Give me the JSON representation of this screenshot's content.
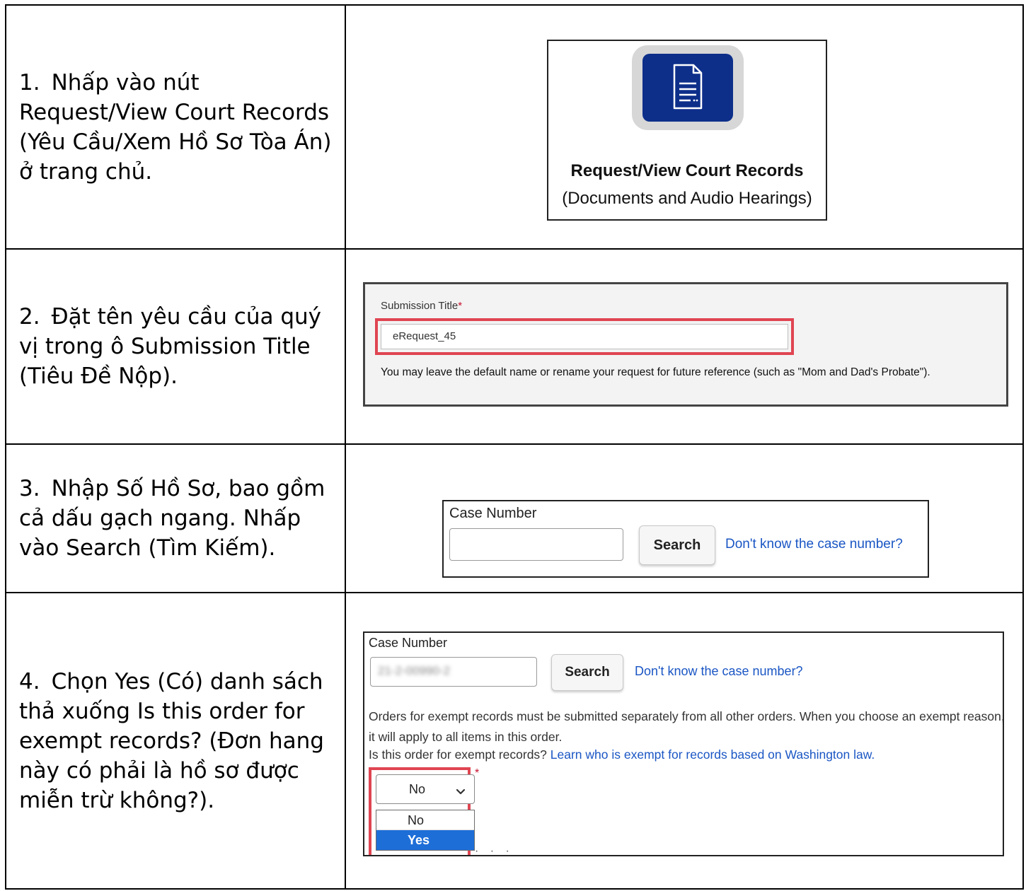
{
  "steps": [
    {
      "number": "1.",
      "instruction": "Nhấp vào nút Request/View Court Records (Yêu Cầu/Xem Hồ Sơ Tòa Án) ở trang chủ."
    },
    {
      "number": "2.",
      "instruction": "Đặt tên yêu cầu của quý vị trong ô Submission Title (Tiêu Đề Nộp)."
    },
    {
      "number": "3.",
      "instruction": "Nhập Số Hồ Sơ, bao gồm cả dấu gạch ngang. Nhấp vào Search (Tìm Kiếm)."
    },
    {
      "number": "4.",
      "instruction": "Chọn Yes (Có) danh sách thả xuống Is this order for exempt records? (Đơn hang này có phải là hồ sơ được miễn trừ không?)."
    }
  ],
  "tile": {
    "icon": "document-icon",
    "title": "Request/View Court Records",
    "subtitle": "(Documents and Audio Hearings)",
    "icon_bg": "#0d2f8a"
  },
  "submission": {
    "label": "Submission Title",
    "required_mark": "*",
    "value": "eRequest_45",
    "help": "You may leave the default name or rename your request for future reference (such as \"Mom and Dad's Probate\")."
  },
  "case_search": {
    "label": "Case Number",
    "input_value": "",
    "search_label": "Search",
    "link": "Don't know the case number?"
  },
  "order": {
    "case_label": "Case Number",
    "case_value_blurred": "21-2-00990-2",
    "search_label": "Search",
    "link": "Don't know the case number?",
    "note": "Orders for exempt records must be submitted separately from all other orders. When you choose an exempt reason, it will apply to all items in this order.",
    "question": "Is this order for exempt records?",
    "question_link": "Learn who is exempt for records based on Washington law.",
    "select_value": "No",
    "required_mark": "*",
    "options": [
      "No",
      "Yes"
    ],
    "highlighted_option": "Yes"
  },
  "colors": {
    "highlight": "#e04552",
    "link": "#1a56c4",
    "selected_option": "#1e6ed8"
  }
}
